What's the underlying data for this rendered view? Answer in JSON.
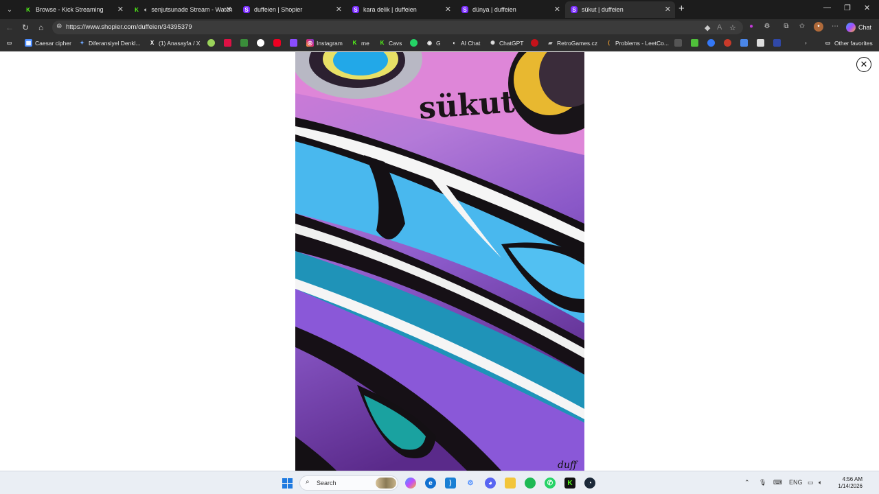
{
  "tabs": [
    {
      "title": "Browse - Kick Streaming",
      "favicon": "kick-icon",
      "active": false
    },
    {
      "title": "senjutsunade Stream - Watch",
      "favicon": "kick-icon",
      "audio": true,
      "active": false
    },
    {
      "title": "duffeien | Shopier",
      "favicon": "shopier-icon",
      "active": false
    },
    {
      "title": "kara delik | duffeien",
      "favicon": "shopier-icon",
      "active": false
    },
    {
      "title": "dünya | duffeien",
      "favicon": "shopier-icon",
      "active": false
    },
    {
      "title": "sükut | duffeien",
      "favicon": "shopier-icon",
      "active": true
    }
  ],
  "address": {
    "url": "https://www.shopier.com/duffeien/34395379"
  },
  "chat_label": "Chat",
  "bookmarks": [
    {
      "label": "Caesar cipher"
    },
    {
      "label": "Diferansiyel Denkl..."
    },
    {
      "label": "(1) Anasayfa / X"
    },
    {
      "label": "G"
    },
    {
      "label": "Instagram"
    },
    {
      "label": "me"
    },
    {
      "label": "Cavs"
    },
    {
      "label": "G"
    },
    {
      "label": "AI Chat"
    },
    {
      "label": "ChatGPT"
    },
    {
      "label": "RetroGames.cz"
    },
    {
      "label": "Problems - LeetCo..."
    },
    {
      "label": "Other favorites"
    }
  ],
  "artwork": {
    "title_text": "sükut",
    "signature": "duff"
  },
  "taskbar": {
    "search_placeholder": "Search",
    "lang": "ENG",
    "time": "4:56 AM",
    "date": "1/14/2026"
  },
  "colors": {
    "tab_strip": "#1c1c1c",
    "toolbar": "#2e2e2e",
    "shopier_purple": "#7a2cff",
    "kick_green": "#53fc18",
    "taskbar": "#eaeef4"
  }
}
